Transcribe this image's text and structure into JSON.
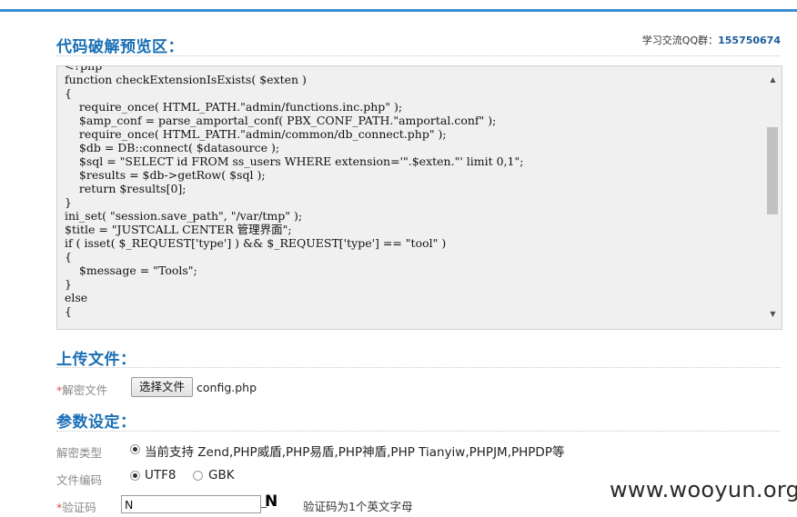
{
  "header": {
    "preview_title": "代码破解预览区：",
    "qq_label": "学习交流QQ群：",
    "qq_number": "155750674"
  },
  "code_preview": {
    "lines": [
      "<?php",
      "function checkExtensionIsExists( $exten )",
      "{",
      "    require_once( HTML_PATH.\"admin/functions.inc.php\" );",
      "    $amp_conf = parse_amportal_conf( PBX_CONF_PATH.\"amportal.conf\" );",
      "    require_once( HTML_PATH.\"admin/common/db_connect.php\" );",
      "    $db = DB::connect( $datasource );",
      "    $sql = \"SELECT id FROM ss_users WHERE extension='\".$exten.\"' limit 0,1\";",
      "    $results = $db->getRow( $sql );",
      "    return $results[0];",
      "}",
      "ini_set( \"session.save_path\", \"/var/tmp\" );",
      "$title = \"JUSTCALL CENTER 管理界面\";",
      "if ( isset( $_REQUEST['type'] ) && $_REQUEST['type'] == \"tool\" )",
      "{",
      "    $message = \"Tools\";",
      "}",
      "else",
      "{"
    ]
  },
  "upload": {
    "section_title": "上传文件：",
    "file_label": "解密文件",
    "file_button": "选择文件",
    "file_name": "config.php"
  },
  "params": {
    "section_title": "参数设定：",
    "decrypt_type_label": "解密类型",
    "decrypt_type_option": "当前支持 Zend,PHP威盾,PHP易盾,PHP神盾,PHP Tianyiw,PHPJM,PHPDP等",
    "encoding_label": "文件编码",
    "encoding_options": [
      "UTF8",
      "GBK"
    ],
    "encoding_selected": "UTF8",
    "captcha_label": "验证码",
    "captcha_value": "N",
    "captcha_image_text": "N",
    "captcha_hint": "验证码为1个英文字母"
  },
  "watermark": "www.wooyun.org",
  "colors": {
    "accent": "#3a8fd2",
    "title": "#1a6fb5",
    "required": "#d9534f"
  }
}
